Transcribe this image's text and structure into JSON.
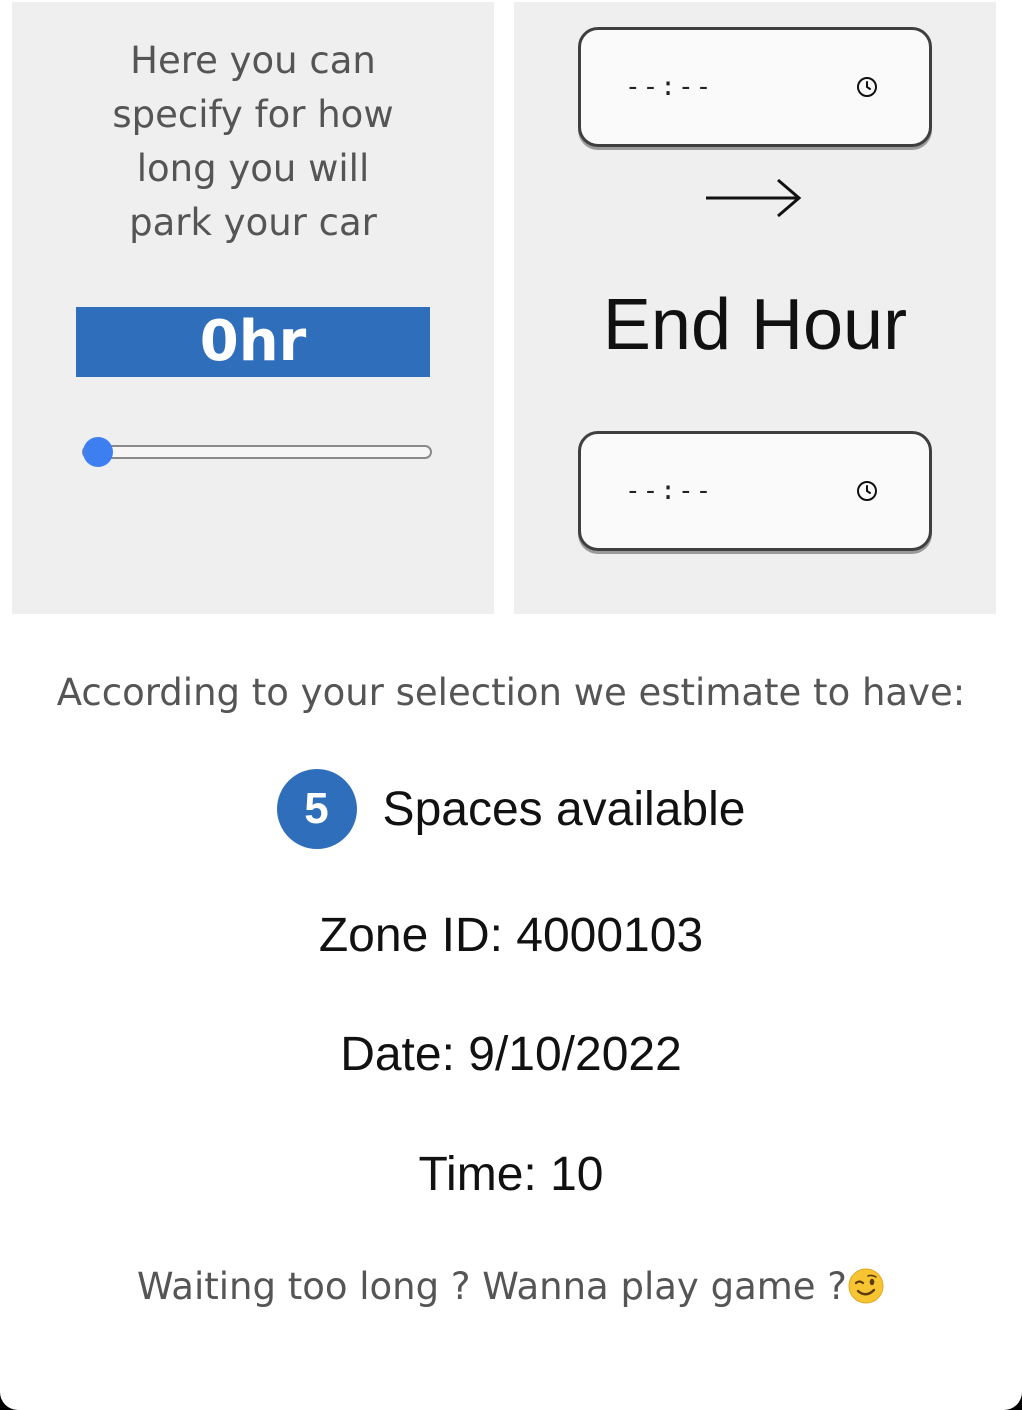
{
  "duration_panel": {
    "intro_text": "Here you can specify for how long you will park your car",
    "duration_value": "0hr",
    "slider_level": 0
  },
  "time_panel": {
    "start_time_value": "--:--",
    "end_hour_label": "End Hour",
    "end_time_value": "--:--",
    "arrow_icon": "right-arrow-icon",
    "clock_icon": "clock-icon"
  },
  "estimate": {
    "intro_text": "According to your selection we estimate to have:",
    "spaces_count": "5",
    "spaces_label": "Spaces available",
    "zone_line": "Zone ID: 4000103",
    "date_line": "Date: 9/10/2022",
    "time_line": "Time: 10"
  },
  "game_prompt": {
    "text": "Waiting too long ? Wanna play game ?",
    "emoji_icon": "wink-emoji-icon"
  },
  "colors": {
    "accent": "#2f6ebb",
    "slider_thumb": "#3d7ef0",
    "panel_background": "#efefef"
  }
}
